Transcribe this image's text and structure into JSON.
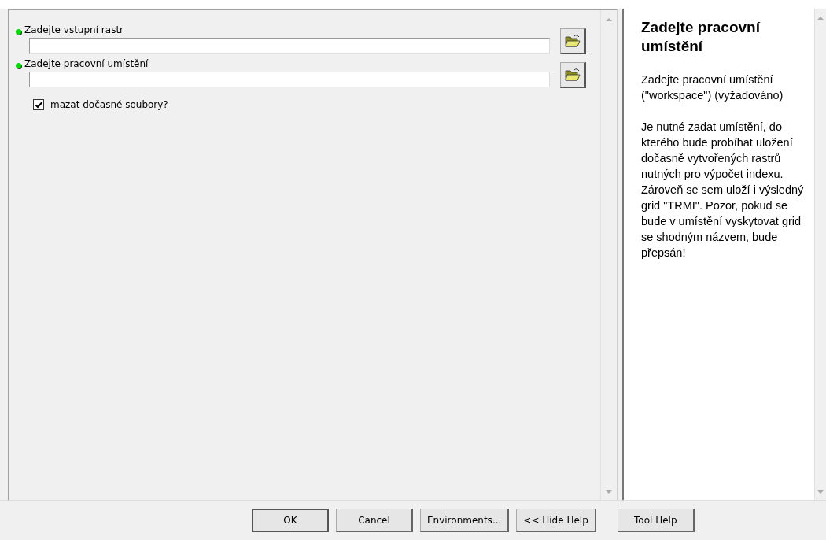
{
  "parameters": [
    {
      "label": "Zadejte vstupní rastr",
      "required": true,
      "kind": "path"
    },
    {
      "label": "Zadejte pracovní umístění",
      "required": true,
      "kind": "path"
    },
    {
      "label": "mazat dočasné soubory?",
      "checked": true,
      "kind": "checkbox"
    }
  ],
  "help": {
    "title": "Zadejte pracovní umístění",
    "paragraphs": [
      "Zadejte pracovní umístění (\"workspace\") (vyžadováno)",
      "Je nutné zadat umístění, do kterého bude probíhat uložení dočasně vytvořených rastrů nutných pro výpočet indexu. Zároveň se sem uloží i výsledný grid \"TRMI\". Pozor, pokud se bude v umístění vyskytovat grid se shodným názvem, bude přepsán!"
    ]
  },
  "buttons": [
    {
      "label": "OK",
      "kind": "default"
    },
    {
      "label": "Cancel",
      "kind": "normal"
    },
    {
      "label": "Environments...",
      "kind": "normal"
    },
    {
      "label": "<< Hide Help",
      "kind": "normal"
    },
    {
      "label": "Tool Help",
      "kind": "separate"
    }
  ]
}
